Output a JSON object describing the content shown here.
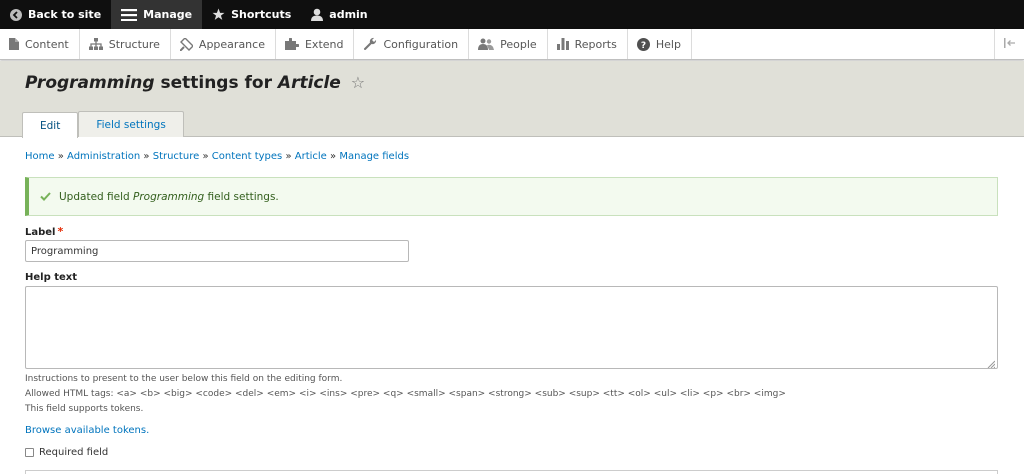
{
  "toolbar": {
    "back_to_site": "Back to site",
    "manage": "Manage",
    "shortcuts": "Shortcuts",
    "user": "admin"
  },
  "tray": {
    "items": [
      {
        "label": "Content",
        "icon": "file-icon"
      },
      {
        "label": "Structure",
        "icon": "sitemap-icon"
      },
      {
        "label": "Appearance",
        "icon": "paintbrush-icon"
      },
      {
        "label": "Extend",
        "icon": "puzzle-icon"
      },
      {
        "label": "Configuration",
        "icon": "wrench-icon"
      },
      {
        "label": "People",
        "icon": "people-icon"
      },
      {
        "label": "Reports",
        "icon": "bar-chart-icon"
      },
      {
        "label": "Help",
        "icon": "help-icon"
      }
    ]
  },
  "header": {
    "title_field": "Programming",
    "title_middle": " settings for ",
    "title_type": "Article",
    "tabs": [
      {
        "label": "Edit",
        "active": true
      },
      {
        "label": "Field settings",
        "active": false
      }
    ]
  },
  "breadcrumb": {
    "items": [
      "Home",
      "Administration",
      "Structure",
      "Content types",
      "Article",
      "Manage fields"
    ],
    "separator": "»"
  },
  "message": {
    "prefix": "Updated field ",
    "field": "Programming",
    "suffix": " field settings."
  },
  "form": {
    "label_title": "Label",
    "label_value": "Programming",
    "help_title": "Help text",
    "help_value": "",
    "desc_line1": "Instructions to present to the user below this field on the editing form.",
    "desc_line2": "Allowed HTML tags: <a> <b> <big> <code> <del> <em> <i> <ins> <pre> <q> <small> <span> <strong> <sub> <sup> <tt> <ol> <ul> <li> <p> <br> <img>",
    "desc_line3": "This field supports tokens.",
    "tokens_link": "Browse available tokens.",
    "required_label": "Required field"
  },
  "colors": {
    "toolbar_bg": "#0f0f0f",
    "link": "#0074bd",
    "success_border": "#77b259",
    "required": "#e32700"
  }
}
